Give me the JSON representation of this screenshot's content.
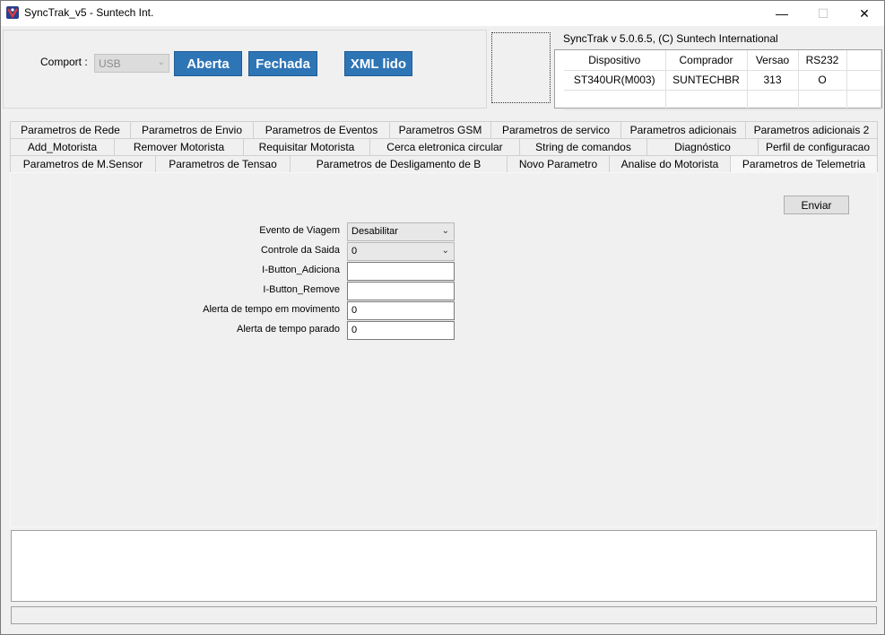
{
  "window": {
    "title": "SyncTrak_v5 - Suntech Int.",
    "minimize": "—",
    "maximize": "☐",
    "close": "✕"
  },
  "top_panel": {
    "comport_label": "Comport :",
    "comport_value": "USB",
    "btn_aberta": "Aberta",
    "btn_fechada": "Fechada",
    "btn_xml": "XML lido",
    "version": "SyncTrak v 5.0.6.5, (C) Suntech International"
  },
  "device_table": {
    "headers": [
      "Dispositivo",
      "Comprador",
      "Versao",
      "RS232",
      ""
    ],
    "row": [
      "ST340UR(M003)",
      "SUNTECHBR",
      "313",
      "O",
      ""
    ]
  },
  "tabs": {
    "row1": [
      "Parametros de Rede",
      "Parametros de Envio",
      "Parametros de Eventos",
      "Parametros GSM",
      "Parametros de servico",
      "Parametros adicionais",
      "Parametros adicionais 2"
    ],
    "row2": [
      "Add_Motorista",
      "Remover Motorista",
      "Requisitar Motorista",
      "Cerca eletronica circular",
      "String de comandos",
      "Diagnóstico",
      "Perfil de configuracao"
    ],
    "row3": [
      "Parametros  de M.Sensor",
      "Parametros de Tensao",
      "Parametros de Desligamento de B",
      "Novo Parametro",
      "Analise do Motorista",
      "Parametros de Telemetria"
    ]
  },
  "form": {
    "send_button": "Enviar",
    "fields": [
      {
        "label": "Evento de Viagem",
        "value": "Desabilitar"
      },
      {
        "label": "Controle da Saida",
        "value": "0"
      },
      {
        "label": "I-Button_Adiciona",
        "value": ""
      },
      {
        "label": "I-Button_Remove",
        "value": ""
      },
      {
        "label": "Alerta de tempo em movimento",
        "value": "0"
      },
      {
        "label": "Alerta de tempo parado",
        "value": "0"
      }
    ]
  }
}
